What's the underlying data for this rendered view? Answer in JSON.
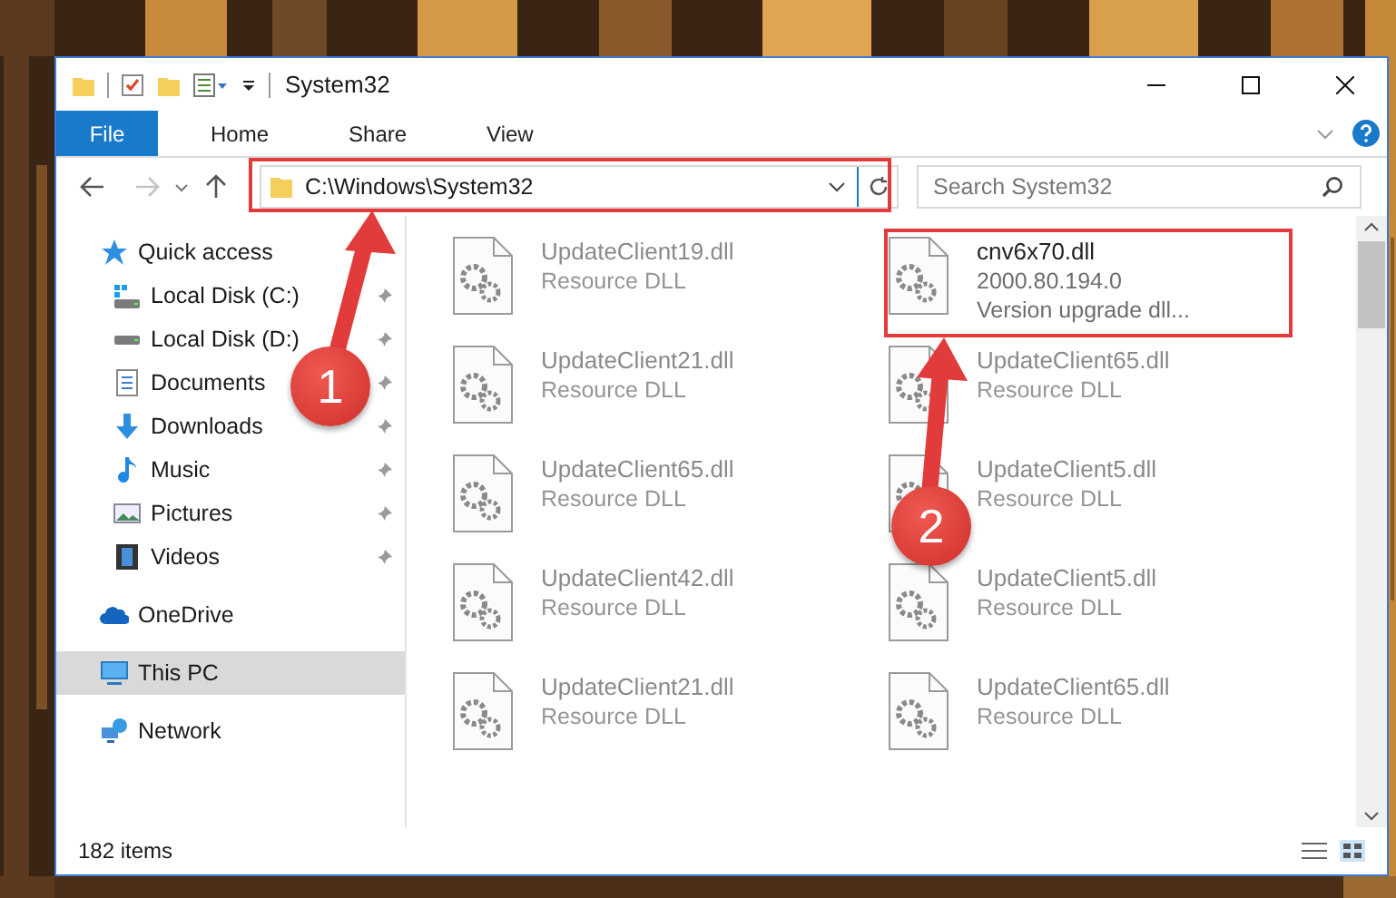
{
  "window": {
    "title": "System32"
  },
  "ribbon": {
    "file_tab": "File",
    "tabs": [
      {
        "label": "Home",
        "selected": false
      },
      {
        "label": "Share",
        "selected": false
      },
      {
        "label": "View",
        "selected": false
      }
    ]
  },
  "address": {
    "path": "C:\\Windows\\System32"
  },
  "search": {
    "placeholder": "Search System32"
  },
  "sidebar": {
    "items": [
      {
        "label": "Quick access",
        "kind": "star",
        "selected": false,
        "children": [
          {
            "label": "Local Disk (C:)",
            "kind": "system-drive",
            "pinned": true,
            "selected": false
          },
          {
            "label": "Local Disk (D:)",
            "kind": "drive",
            "pinned": true,
            "selected": false
          },
          {
            "label": "Documents",
            "kind": "documents",
            "pinned": true,
            "selected": false
          },
          {
            "label": "Downloads",
            "kind": "downloads",
            "pinned": true,
            "selected": false
          },
          {
            "label": "Music",
            "kind": "music",
            "pinned": true,
            "selected": false
          },
          {
            "label": "Pictures",
            "kind": "pictures",
            "pinned": true,
            "selected": false
          },
          {
            "label": "Videos",
            "kind": "videos",
            "pinned": true,
            "selected": false
          }
        ]
      },
      {
        "label": "OneDrive",
        "kind": "cloud",
        "selected": false
      },
      {
        "label": "This PC",
        "kind": "pc",
        "selected": true
      },
      {
        "label": "Network",
        "kind": "network",
        "selected": false
      }
    ]
  },
  "files": [
    {
      "name": "UpdateClient19.dll",
      "lines": [
        "Resource DLL"
      ],
      "blurred": true
    },
    {
      "name": "cnv6x70.dll",
      "lines": [
        "2000.80.194.0",
        "Version upgrade dll..."
      ],
      "blurred": false
    },
    {
      "name": "UpdateClient21.dll",
      "lines": [
        "Resource DLL"
      ],
      "blurred": true
    },
    {
      "name": "UpdateClient65.dll",
      "lines": [
        "Resource DLL"
      ],
      "blurred": true
    },
    {
      "name": "UpdateClient65.dll",
      "lines": [
        "Resource DLL"
      ],
      "blurred": true
    },
    {
      "name": "UpdateClient5.dll",
      "lines": [
        "Resource DLL"
      ],
      "blurred": true
    },
    {
      "name": "UpdateClient42.dll",
      "lines": [
        "Resource DLL"
      ],
      "blurred": true
    },
    {
      "name": "UpdateClient5.dll",
      "lines": [
        "Resource DLL"
      ],
      "blurred": true
    },
    {
      "name": "UpdateClient21.dll",
      "lines": [
        "Resource DLL"
      ],
      "blurred": true
    },
    {
      "name": "UpdateClient65.dll",
      "lines": [
        "Resource DLL"
      ],
      "blurred": true
    }
  ],
  "annotations": [
    {
      "label": "1"
    },
    {
      "label": "2"
    }
  ],
  "status_bar": {
    "item_count": "182 items"
  }
}
